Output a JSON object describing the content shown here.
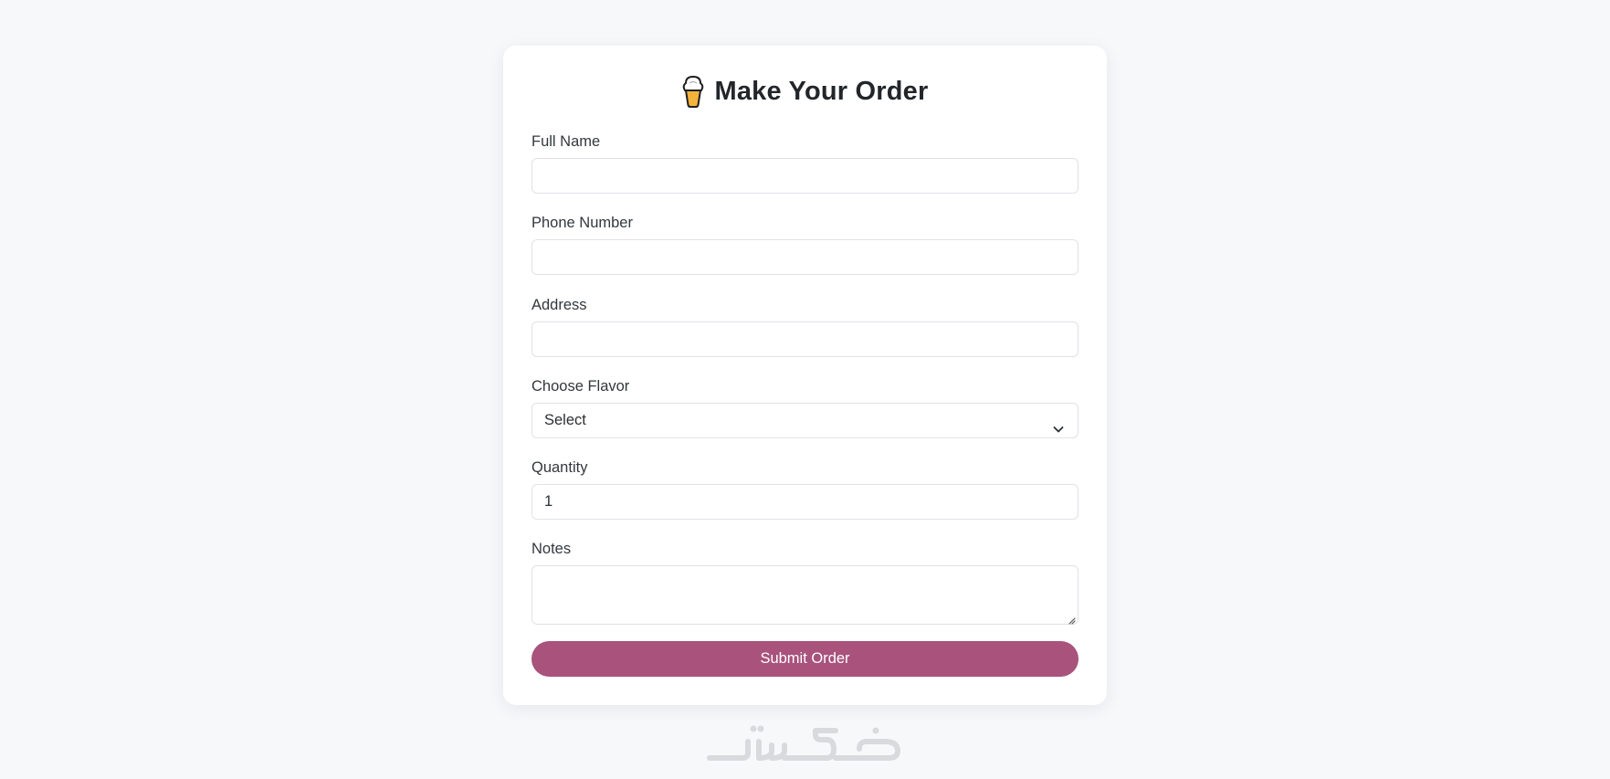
{
  "form": {
    "title": "Make Your Order",
    "title_icon": "ice-cream-icon",
    "fields": {
      "full_name": {
        "label": "Full Name",
        "value": "",
        "placeholder": ""
      },
      "phone": {
        "label": "Phone Number",
        "value": "",
        "placeholder": ""
      },
      "address": {
        "label": "Address",
        "value": "",
        "placeholder": ""
      },
      "flavor": {
        "label": "Choose Flavor",
        "selected": "Select"
      },
      "quantity": {
        "label": "Quantity",
        "value": "1"
      },
      "notes": {
        "label": "Notes",
        "value": ""
      }
    },
    "submit_label": "Submit Order"
  },
  "watermark": {
    "text": "خمسات"
  },
  "colors": {
    "background": "#f7f8fa",
    "card": "#ffffff",
    "accent": "#a8527c",
    "border": "#dfe2e6",
    "text": "#2b2f33"
  }
}
